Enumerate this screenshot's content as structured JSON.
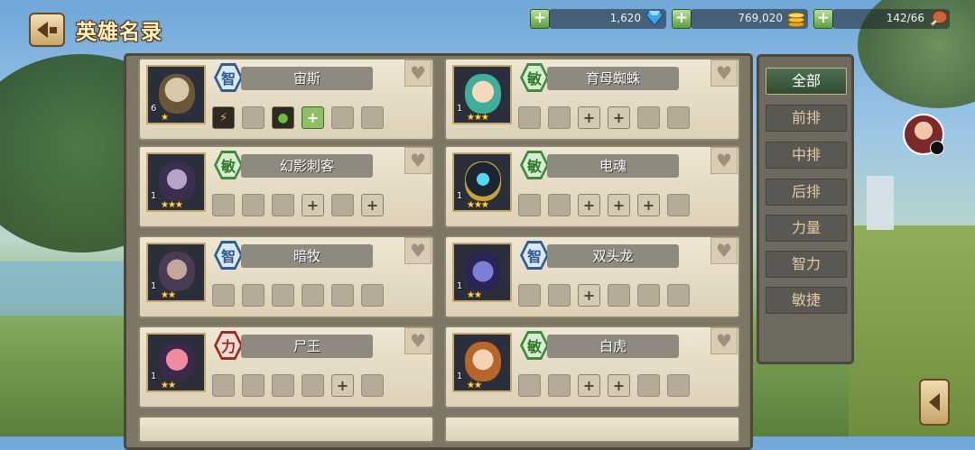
{
  "header": {
    "title": "英雄名录"
  },
  "resources": {
    "diamonds": "1,620",
    "gold": "769,020",
    "stamina": "142/66"
  },
  "heroes": [
    {
      "name": "宙斯",
      "attr": "智",
      "attr_class": "attr-zhi",
      "level": "6",
      "stars": "★",
      "slots": [
        "filled",
        "filled-green",
        "empty",
        "plus-green",
        "empty",
        "empty"
      ]
    },
    {
      "name": "育母蜘蛛",
      "attr": "敏",
      "attr_class": "attr-min",
      "level": "1",
      "stars": "★★★",
      "slots": [
        "empty",
        "empty",
        "plus",
        "plus",
        "empty",
        "empty"
      ]
    },
    {
      "name": "幻影刺客",
      "attr": "敏",
      "attr_class": "attr-min",
      "level": "1",
      "stars": "★★★",
      "slots": [
        "empty",
        "empty",
        "empty",
        "plus",
        "empty",
        "plus"
      ]
    },
    {
      "name": "电魂",
      "attr": "敏",
      "attr_class": "attr-min",
      "level": "1",
      "stars": "★★★",
      "slots": [
        "empty",
        "empty",
        "plus",
        "plus",
        "plus",
        "empty"
      ]
    },
    {
      "name": "暗牧",
      "attr": "智",
      "attr_class": "attr-zhi",
      "level": "1",
      "stars": "★★",
      "slots": [
        "empty",
        "empty",
        "empty",
        "empty",
        "empty",
        "empty"
      ]
    },
    {
      "name": "双头龙",
      "attr": "智",
      "attr_class": "attr-zhi",
      "level": "1",
      "stars": "★★",
      "slots": [
        "empty",
        "empty",
        "plus",
        "empty",
        "empty",
        "empty"
      ]
    },
    {
      "name": "尸王",
      "attr": "力",
      "attr_class": "attr-li",
      "level": "1",
      "stars": "★★",
      "slots": [
        "empty",
        "empty",
        "empty",
        "empty",
        "plus",
        "empty"
      ]
    },
    {
      "name": "白虎",
      "attr": "敏",
      "attr_class": "attr-min",
      "level": "1",
      "stars": "★★",
      "slots": [
        "empty",
        "empty",
        "plus",
        "plus",
        "empty",
        "empty"
      ]
    }
  ],
  "filters": {
    "all": "全部",
    "front": "前排",
    "middle": "中排",
    "back": "后排",
    "strength": "力量",
    "intelligence": "智力",
    "agility": "敏捷"
  },
  "icons": {
    "back": "back-arrow-icon",
    "diamond": "diamond-icon",
    "gold": "gold-coin-icon",
    "stamina": "drumstick-icon",
    "heart": "heart-icon",
    "collapse": "chevron-left-icon"
  },
  "colors": {
    "attr_int": "#2e5d93",
    "attr_agi": "#3f8a3c",
    "attr_str": "#9b2c20",
    "active_filter": "#2f4d32"
  }
}
